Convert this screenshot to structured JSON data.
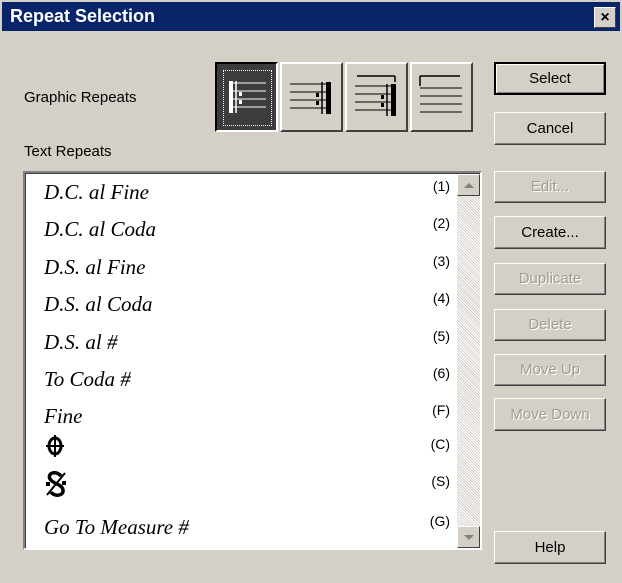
{
  "window": {
    "title": "Repeat Selection",
    "close_glyph": "×"
  },
  "graphic_repeats": {
    "label": "Graphic Repeats",
    "buttons": [
      {
        "icon": "forward-repeat-icon",
        "selected": true
      },
      {
        "icon": "backward-repeat-icon",
        "selected": false
      },
      {
        "icon": "backward-repeat-ending-icon",
        "selected": false
      },
      {
        "icon": "plain-bracket-icon",
        "selected": false
      }
    ]
  },
  "text_repeats": {
    "label": "Text Repeats",
    "items": [
      {
        "text": "D.C. al Fine",
        "key": "(1)"
      },
      {
        "text": "D.C. al Coda",
        "key": "(2)"
      },
      {
        "text": "D.S. al Fine",
        "key": "(3)"
      },
      {
        "text": "D.S. al Coda",
        "key": "(4)"
      },
      {
        "text": "D.S. al #",
        "key": "(5)"
      },
      {
        "text": "To Coda #",
        "key": "(6)"
      },
      {
        "text": "Fine",
        "key": "(F)"
      },
      {
        "text": "",
        "symbol": "coda-symbol-icon",
        "key": "(C)"
      },
      {
        "text": "",
        "symbol": "segno-symbol-icon",
        "key": "(S)"
      },
      {
        "text": "Go To Measure #",
        "key": "(G)"
      }
    ]
  },
  "buttons": {
    "select": "Select",
    "cancel": "Cancel",
    "edit": "Edit...",
    "create": "Create...",
    "duplicate": "Duplicate",
    "delete": "Delete",
    "move_up": "Move Up",
    "move_down": "Move Down",
    "help": "Help"
  },
  "colors": {
    "titlebar": "#0a246a",
    "face": "#d4d0c8",
    "disabled_text": "#a09c94"
  }
}
